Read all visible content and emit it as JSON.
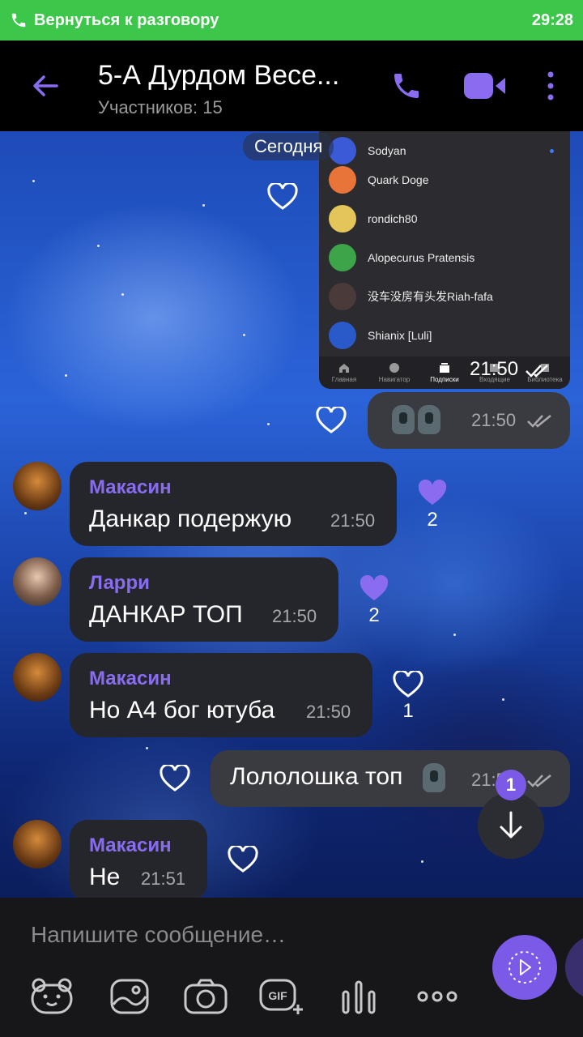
{
  "callbar": {
    "return_label": "Вернуться к разговору",
    "time": "29:28",
    "color": "#3cc64a"
  },
  "header": {
    "title": "5-А Дурдом Весе...",
    "subtitle": "Участников: 15",
    "accent": "#8a6cf0"
  },
  "chat": {
    "date_chip": "Сегодня",
    "screenshot": {
      "rows": [
        {
          "name": "Sodyan",
          "color": "#3b5bd6"
        },
        {
          "name": "Quark Doge",
          "color": "#e8743a"
        },
        {
          "name": "rondich80",
          "color": "#e3c55a"
        },
        {
          "name": "Alopecurus Pratensis",
          "color": "#3ea44a"
        },
        {
          "name": "没车没房有头发Riah-fafa",
          "color": "#4a3a3a"
        },
        {
          "name": "Shianix [Luli]",
          "color": "#2a59c9"
        }
      ],
      "tabs": [
        "Главная",
        "Навигатор",
        "Подписки",
        "Входящие",
        "Библиотека"
      ],
      "time": "21:50"
    },
    "messages": [
      {
        "id": "m1",
        "direction": "out",
        "time": "21:50",
        "content": "emoji"
      },
      {
        "id": "m2",
        "direction": "in",
        "sender": "Макасин",
        "text": "Данкар подержую",
        "time": "21:50",
        "likes": "2"
      },
      {
        "id": "m3",
        "direction": "in",
        "sender": "Ларри",
        "text": "ДАНКАР ТОП",
        "time": "21:50",
        "likes": "2"
      },
      {
        "id": "m4",
        "direction": "in",
        "sender": "Макасин",
        "text": "Но А4 бог ютуба",
        "time": "21:50",
        "likes": "1"
      },
      {
        "id": "m5",
        "direction": "out",
        "text": "Лололошка топ",
        "time": "21:50"
      },
      {
        "id": "m6",
        "direction": "in",
        "sender": "Макасин",
        "text": "Не",
        "time": "21:51"
      }
    ],
    "unread_count": "1"
  },
  "composer": {
    "placeholder": "Напишите сообщение…"
  },
  "icons": [
    "phone-icon",
    "back-arrow-icon",
    "call-icon",
    "video-icon",
    "more-icon",
    "heart-icon",
    "read-ticks-icon",
    "scroll-down-icon",
    "sticker-icon",
    "gallery-icon",
    "camera-icon",
    "gif-icon",
    "voice-icon",
    "more-tools-icon",
    "send-icon"
  ]
}
